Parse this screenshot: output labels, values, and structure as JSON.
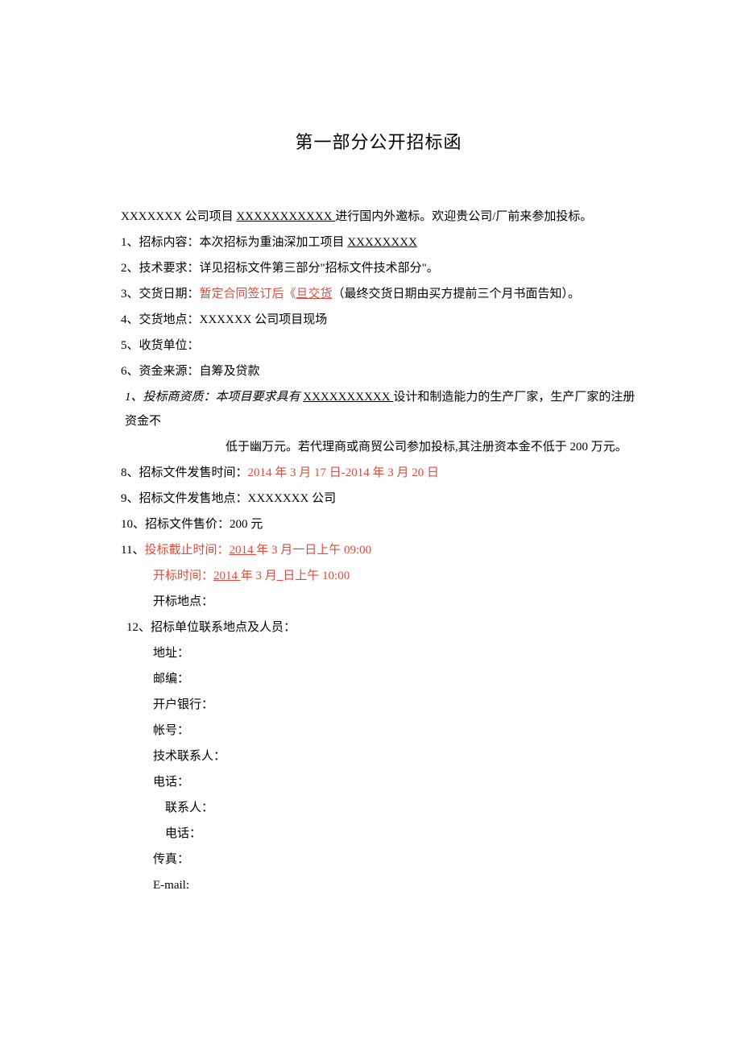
{
  "title": "第一部分公开招标函",
  "intro": {
    "prefix": "XXXXXXX 公司项目 ",
    "underlined": "XXXXXXXXXXX ",
    "suffix": "进行国内外邀标。欢迎贵公司/厂前来参加投标。"
  },
  "items": {
    "i1": {
      "label": "1、招标内容：本次招标为重油深加工项目 ",
      "underlined": "XXXXXXXX"
    },
    "i2": "2、技术要求：详见招标文件第三部分\"招标文件技术部分\"。",
    "i3": {
      "label": "3、交货日期：",
      "red1": "暂定合同签订后《",
      "red_underline": "旦交货",
      "suffix": "（最终交货日期由买方提前三个月书面告知）。"
    },
    "i4": "4、交货地点：XXXXXX 公司项目现场",
    "i5": "5、收货单位：",
    "i6": "6、资金来源：自筹及贷款",
    "i7": {
      "line1_prefix": "1、投标商资质：本项目要求具有 ",
      "line1_underlined": "XXXXXXXXXX ",
      "line1_suffix": "设计和制造能力的生产厂家，生产厂家的注册资金不",
      "line2": "低于幽万元。若代理商或商贸公司参加投标,其注册资本金不低于 200 万元。"
    },
    "i8": {
      "label": "8、招标文件发售时间：",
      "red": "2014 年 3 月 17 日-2014 年 3 月 20 日"
    },
    "i9": "9、招标文件发售地点：XXXXXXX 公司",
    "i10": "10、招标文件售价：200 元",
    "i11": {
      "line1_label": "11、",
      "line1_red": "投标截止时间：",
      "line1_red_underline": "2014 ",
      "line1_red_suffix": "年 3 月一日上午 09:00",
      "line2_red": "开标时间：",
      "line2_red_underline": "2014 ",
      "line2_red_mid": "年 3 月",
      "line2_red_underline2": "_",
      "line2_red_suffix": "日上午 10:00",
      "line3": "开标地点："
    },
    "i12": {
      "header": "12、招标单位联系地点及人员：",
      "rows": {
        "addr": "地址：",
        "postcode": "邮编：",
        "bank": "开户银行：",
        "account": "帐号：",
        "tech_contact": "技术联系人：",
        "tel1": "电话：",
        "contact": "联系人：",
        "tel2": "电话：",
        "fax": "传真：",
        "email": "E-mail:"
      }
    }
  }
}
